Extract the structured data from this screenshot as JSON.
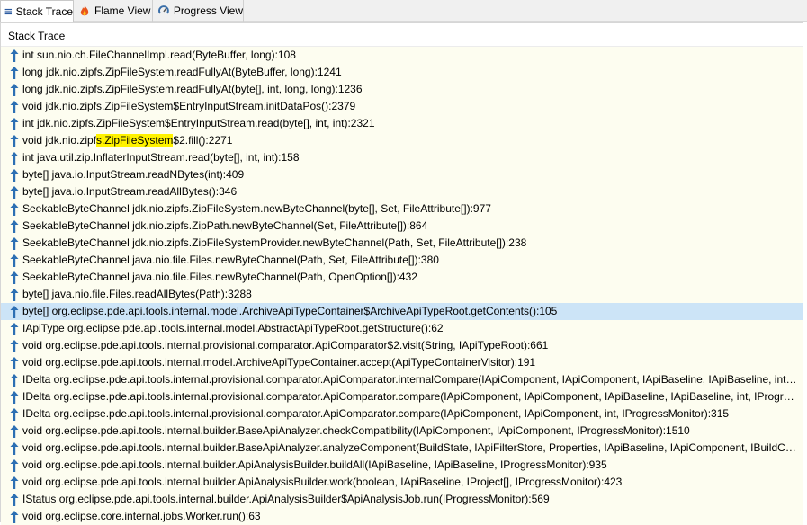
{
  "tabs": [
    {
      "label": "Stack Trace",
      "icon": "list-icon",
      "active": true
    },
    {
      "label": "Flame View",
      "icon": "flame-icon",
      "active": false
    },
    {
      "label": "Progress View",
      "icon": "progress-icon",
      "active": false
    }
  ],
  "panel": {
    "title": "Stack Trace"
  },
  "colors": {
    "row_bg": "#fdfdf0",
    "selected_bg": "#cce4f7",
    "highlight": "#fff200",
    "arrow": "#2c6fb3"
  },
  "frames": [
    {
      "text": "int sun.nio.ch.FileChannelImpl.read(ByteBuffer, long):108"
    },
    {
      "text": "long jdk.nio.zipfs.ZipFileSystem.readFullyAt(ByteBuffer, long):1241"
    },
    {
      "text": "long jdk.nio.zipfs.ZipFileSystem.readFullyAt(byte[], int, long, long):1236"
    },
    {
      "text": "void jdk.nio.zipfs.ZipFileSystem$EntryInputStream.initDataPos():2379"
    },
    {
      "text": "int jdk.nio.zipfs.ZipFileSystem$EntryInputStream.read(byte[], int, int):2321"
    },
    {
      "text": "void jdk.nio.zipfs.ZipFileSystem$2.fill():2271",
      "pre": "void jdk.nio.zipf",
      "highlight": "s.ZipFileSystem",
      "post": "$2.fill():2271"
    },
    {
      "text": "int java.util.zip.InflaterInputStream.read(byte[], int, int):158"
    },
    {
      "text": "byte[] java.io.InputStream.readNBytes(int):409"
    },
    {
      "text": "byte[] java.io.InputStream.readAllBytes():346"
    },
    {
      "text": "SeekableByteChannel jdk.nio.zipfs.ZipFileSystem.newByteChannel(byte[], Set, FileAttribute[]):977"
    },
    {
      "text": "SeekableByteChannel jdk.nio.zipfs.ZipPath.newByteChannel(Set, FileAttribute[]):864"
    },
    {
      "text": "SeekableByteChannel jdk.nio.zipfs.ZipFileSystemProvider.newByteChannel(Path, Set, FileAttribute[]):238"
    },
    {
      "text": "SeekableByteChannel java.nio.file.Files.newByteChannel(Path, Set, FileAttribute[]):380"
    },
    {
      "text": "SeekableByteChannel java.nio.file.Files.newByteChannel(Path, OpenOption[]):432"
    },
    {
      "text": "byte[] java.nio.file.Files.readAllBytes(Path):3288"
    },
    {
      "text": "byte[] org.eclipse.pde.api.tools.internal.model.ArchiveApiTypeContainer$ArchiveApiTypeRoot.getContents():105",
      "selected": true
    },
    {
      "text": "IApiType org.eclipse.pde.api.tools.internal.model.AbstractApiTypeRoot.getStructure():62"
    },
    {
      "text": "void org.eclipse.pde.api.tools.internal.provisional.comparator.ApiComparator$2.visit(String, IApiTypeRoot):661"
    },
    {
      "text": "void org.eclipse.pde.api.tools.internal.model.ArchiveApiTypeContainer.accept(ApiTypeContainerVisitor):191"
    },
    {
      "text": "IDelta org.eclipse.pde.api.tools.internal.provisional.comparator.ApiComparator.internalCompare(IApiComponent, IApiComponent, IApiBaseline, IApiBaseline, int, ..."
    },
    {
      "text": "IDelta org.eclipse.pde.api.tools.internal.provisional.comparator.ApiComparator.compare(IApiComponent, IApiComponent, IApiBaseline, IApiBaseline, int, IProgres..."
    },
    {
      "text": "IDelta org.eclipse.pde.api.tools.internal.provisional.comparator.ApiComparator.compare(IApiComponent, IApiComponent, int, IProgressMonitor):315"
    },
    {
      "text": "void org.eclipse.pde.api.tools.internal.builder.BaseApiAnalyzer.checkCompatibility(IApiComponent, IApiComponent, IProgressMonitor):1510"
    },
    {
      "text": "void org.eclipse.pde.api.tools.internal.builder.BaseApiAnalyzer.analyzeComponent(BuildState, IApiFilterStore, Properties, IApiBaseline, IApiComponent, IBuildCont..."
    },
    {
      "text": "void org.eclipse.pde.api.tools.internal.builder.ApiAnalysisBuilder.buildAll(IApiBaseline, IApiBaseline, IProgressMonitor):935"
    },
    {
      "text": "void org.eclipse.pde.api.tools.internal.builder.ApiAnalysisBuilder.work(boolean, IApiBaseline, IProject[], IProgressMonitor):423"
    },
    {
      "text": "IStatus org.eclipse.pde.api.tools.internal.builder.ApiAnalysisBuilder$ApiAnalysisJob.run(IProgressMonitor):569"
    },
    {
      "text": "void org.eclipse.core.internal.jobs.Worker.run():63"
    }
  ]
}
